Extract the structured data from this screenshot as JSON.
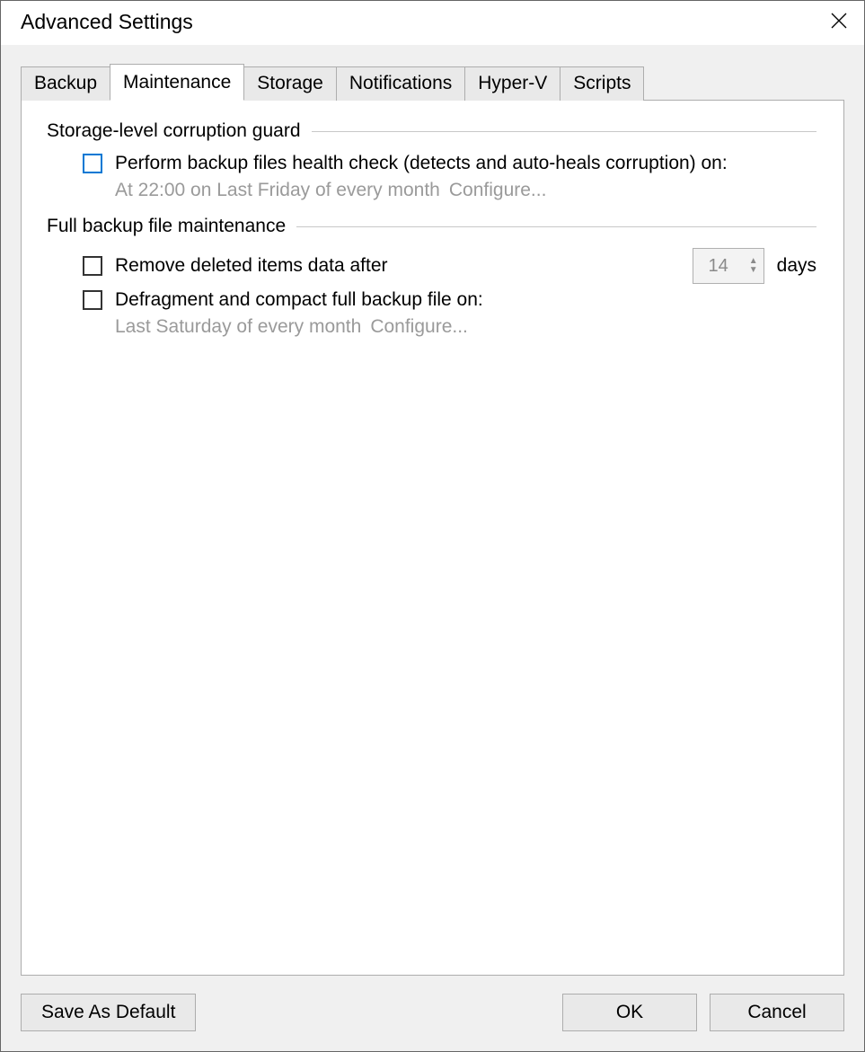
{
  "dialog": {
    "title": "Advanced Settings"
  },
  "tabs": {
    "backup": "Backup",
    "maintenance": "Maintenance",
    "storage": "Storage",
    "notifications": "Notifications",
    "hyperv": "Hyper-V",
    "scripts": "Scripts"
  },
  "maintenance": {
    "group1_title": "Storage-level corruption guard",
    "health_check_label": "Perform backup files health check (detects and auto-heals corruption) on:",
    "health_check_schedule": "At 22:00 on Last Friday of every month",
    "health_check_configure": "Configure...",
    "group2_title": "Full backup file maintenance",
    "remove_label": "Remove deleted items data after",
    "remove_days_value": "14",
    "remove_days_unit": "days",
    "defrag_label": "Defragment and compact full backup file on:",
    "defrag_schedule": "Last Saturday of every month",
    "defrag_configure": "Configure..."
  },
  "buttons": {
    "save_default": "Save As Default",
    "ok": "OK",
    "cancel": "Cancel"
  }
}
